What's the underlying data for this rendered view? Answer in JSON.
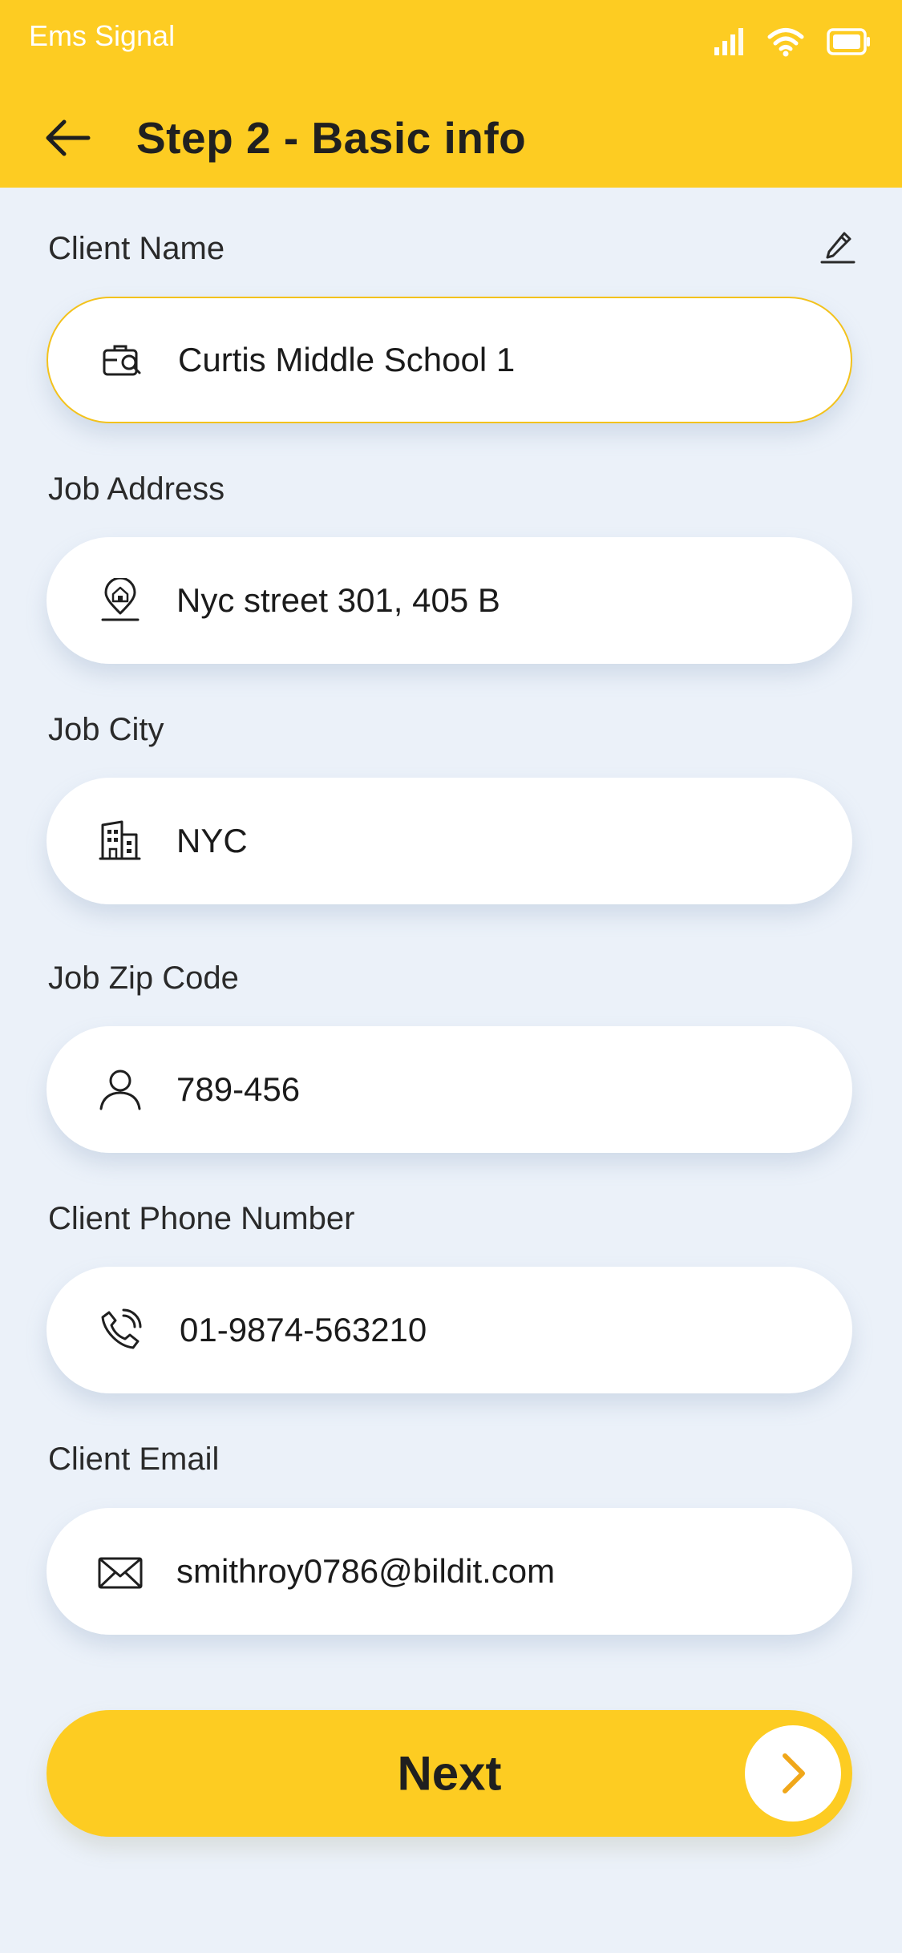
{
  "status_bar": {
    "carrier": "Ems Signal"
  },
  "header": {
    "title": "Step 2 - Basic info"
  },
  "form": {
    "client_name": {
      "label": "Client Name",
      "value": "Curtis Middle School 1",
      "icon": "briefcase-search-icon"
    },
    "job_address": {
      "label": "Job Address",
      "value": "Nyc street 301, 405 B",
      "icon": "home-location-icon"
    },
    "job_city": {
      "label": "Job City",
      "value": "NYC",
      "icon": "buildings-icon"
    },
    "job_zip": {
      "label": "Job Zip Code",
      "value": "789-456",
      "icon": "person-icon"
    },
    "client_phone": {
      "label": "Client Phone Number",
      "value": "01-9874-563210",
      "icon": "phone-call-icon"
    },
    "client_email": {
      "label": "Client Email",
      "value": "smithroy0786@bildit.com",
      "icon": "mail-icon"
    }
  },
  "next_button": {
    "label": "Next"
  },
  "colors": {
    "accent": "#fdcc22",
    "background": "#ebf1f9",
    "arrow": "#f0a71a"
  }
}
